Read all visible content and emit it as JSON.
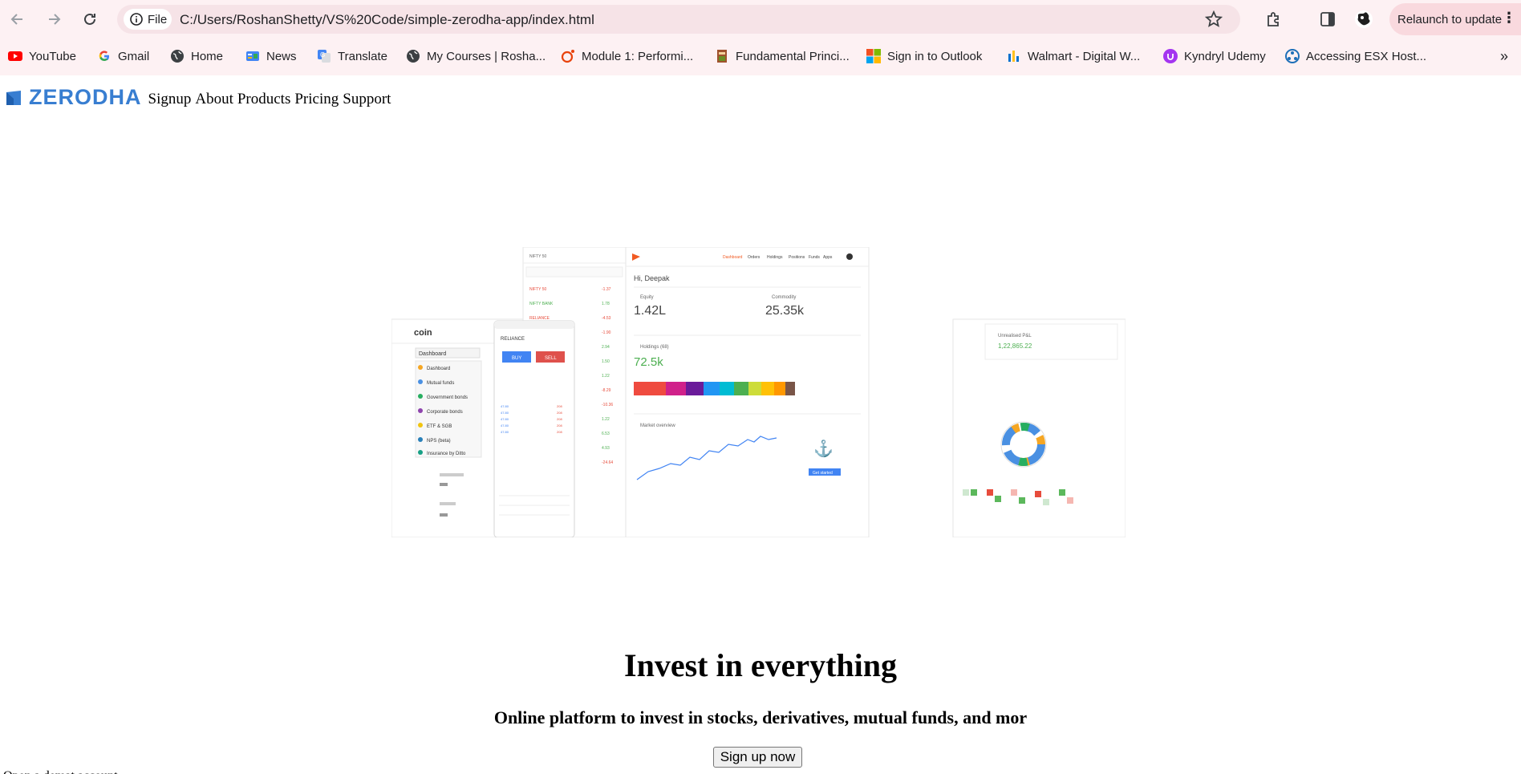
{
  "browser": {
    "site_info_label": "File",
    "url": "C:/Users/RoshanShetty/VS%20Code/simple-zerodha-app/index.html",
    "relaunch_label": "Relaunch to update",
    "bookmarks": [
      {
        "label": "YouTube",
        "icon": "youtube-icon",
        "color": "#ff0000"
      },
      {
        "label": "Gmail",
        "icon": "google-icon",
        "color": "#4285f4"
      },
      {
        "label": "Home",
        "icon": "globe-icon",
        "color": "#3c4043"
      },
      {
        "label": "News",
        "icon": "news-icon",
        "color": "#4285f4"
      },
      {
        "label": "Translate",
        "icon": "translate-icon",
        "color": "#4285f4"
      },
      {
        "label": "My Courses | Rosha...",
        "icon": "globe-icon",
        "color": "#3c4043"
      },
      {
        "label": "Module 1: Performi...",
        "icon": "module-icon",
        "color": "#e8420c"
      },
      {
        "label": "Fundamental Princi...",
        "icon": "book-icon",
        "color": "#a0522d"
      },
      {
        "label": "Sign in to Outlook",
        "icon": "microsoft-icon",
        "color": "#00a4ef"
      },
      {
        "label": "Walmart - Digital W...",
        "icon": "walmart-icon",
        "color": "#0071ce"
      },
      {
        "label": "Kyndryl Udemy",
        "icon": "udemy-icon",
        "color": "#a435f0"
      },
      {
        "label": "Accessing ESX Host...",
        "icon": "esx-icon",
        "color": "#1d6fb8"
      }
    ]
  },
  "site": {
    "logo_text": "ZERODHA",
    "brand_color": "#387ed1",
    "nav_links": [
      "Signup",
      "About",
      "Products",
      "Pricing",
      "Support"
    ],
    "hero_image": {
      "greeting": "Hi, Deepak",
      "equity_label": "Equity",
      "equity_value": "1.42L",
      "commodity_label": "Commodity",
      "commodity_value": "25.35k",
      "holdings_label": "Holdings (68)",
      "holdings_value": "72.5k",
      "market_label": "Market overview",
      "get_started": "Get started",
      "coin_label": "coin",
      "coin_menu": [
        "Dashboard",
        "Mutual funds",
        "Government bonds",
        "Corporate bonds",
        "ETF & SGB",
        "NPS (beta)",
        "Insurance by Ditto"
      ],
      "stock": "RELIANCE",
      "buy": "BUY",
      "sell": "SELL",
      "unrealised_label": "Unrealised P&L",
      "unrealised_value": "1,22,865.22"
    },
    "hero_title": "Invest in everything",
    "hero_subtitle": "Online platform to invest in stocks, derivatives, mutual funds, and mor",
    "cta_label": "Sign up now",
    "footer_text": "Open a demat account"
  }
}
